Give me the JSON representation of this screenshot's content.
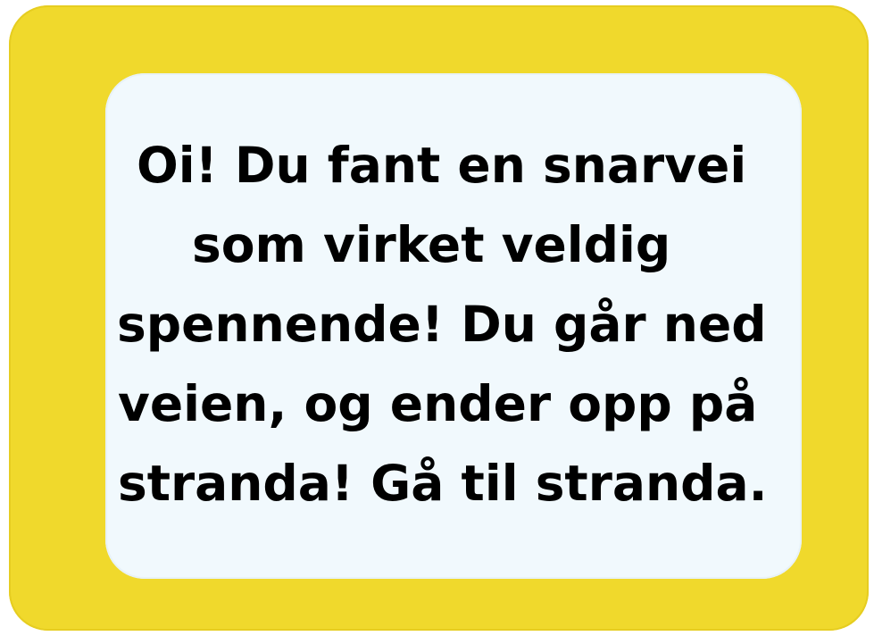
{
  "message": {
    "lines": [
      "Oi! Du fant en snarvei",
      "som virket veldig",
      "spennende! Du går ned",
      "veien, og ender opp på",
      "stranda! Gå til stranda."
    ]
  },
  "colors": {
    "frame": "#f0d92c",
    "panel": "#f1f9fd",
    "text": "#000000"
  }
}
